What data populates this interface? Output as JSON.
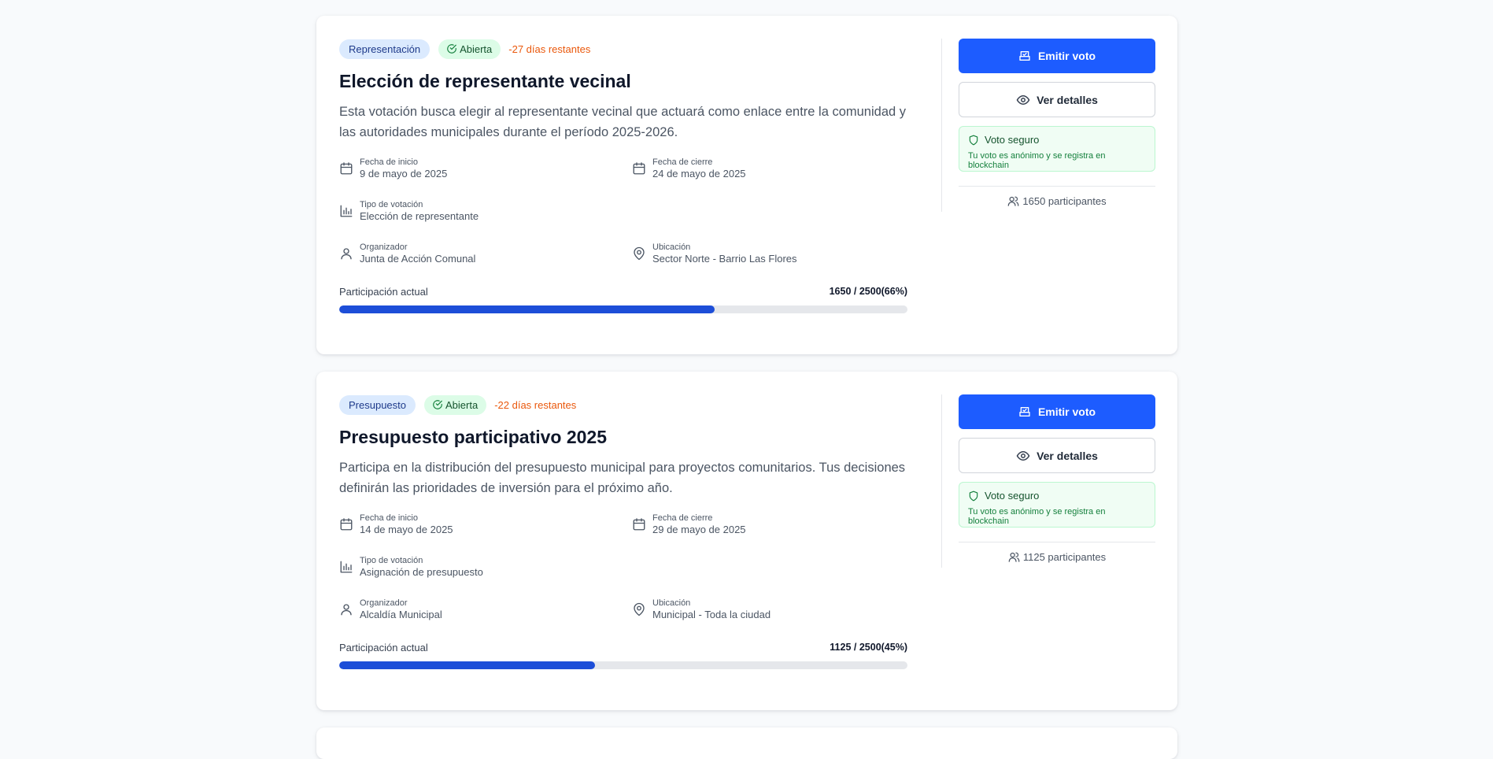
{
  "colors": {
    "accent": "#1d5cff",
    "progress": "#1d4ed8",
    "days_left": "#ea580c",
    "open_badge_bg": "#dcfce7",
    "category_badge_bg": "#dbeafe",
    "secure_bg": "#f0fdf4"
  },
  "votes": [
    {
      "category": "Representación",
      "status": "Abierta",
      "days_left": "-27 días restantes",
      "title": "Elección de representante vecinal",
      "description": "Esta votación busca elegir al representante vecinal que actuará como enlace entre la comunidad y las autoridades municipales durante el período 2025-2026.",
      "start_label": "Fecha de inicio",
      "start_value": "9 de mayo de 2025",
      "end_label": "Fecha de cierre",
      "end_value": "24 de mayo de 2025",
      "type_label": "Tipo de votación",
      "type_value": "Elección de representante",
      "organizer_label": "Organizador",
      "organizer_value": "Junta de Acción Comunal",
      "location_label": "Ubicación",
      "location_value": "Sector Norte - Barrio Las Flores",
      "participation_label": "Participación actual",
      "participation_text": "1650 / 2500(66%)",
      "participation_fraction": 0.66,
      "vote_button": "Emitir voto",
      "details_button": "Ver detalles",
      "secure_title": "Voto seguro",
      "secure_text": "Tu voto es anónimo y se registra en blockchain",
      "participants": "1650 participantes"
    },
    {
      "category": "Presupuesto",
      "status": "Abierta",
      "days_left": "-22 días restantes",
      "title": "Presupuesto participativo 2025",
      "description": "Participa en la distribución del presupuesto municipal para proyectos comunitarios. Tus decisiones definirán las prioridades de inversión para el próximo año.",
      "start_label": "Fecha de inicio",
      "start_value": "14 de mayo de 2025",
      "end_label": "Fecha de cierre",
      "end_value": "29 de mayo de 2025",
      "type_label": "Tipo de votación",
      "type_value": "Asignación de presupuesto",
      "organizer_label": "Organizador",
      "organizer_value": "Alcaldía Municipal",
      "location_label": "Ubicación",
      "location_value": "Municipal - Toda la ciudad",
      "participation_label": "Participación actual",
      "participation_text": "1125 / 2500(45%)",
      "participation_fraction": 0.45,
      "vote_button": "Emitir voto",
      "details_button": "Ver detalles",
      "secure_title": "Voto seguro",
      "secure_text": "Tu voto es anónimo y se registra en blockchain",
      "participants": "1125 participantes"
    }
  ]
}
